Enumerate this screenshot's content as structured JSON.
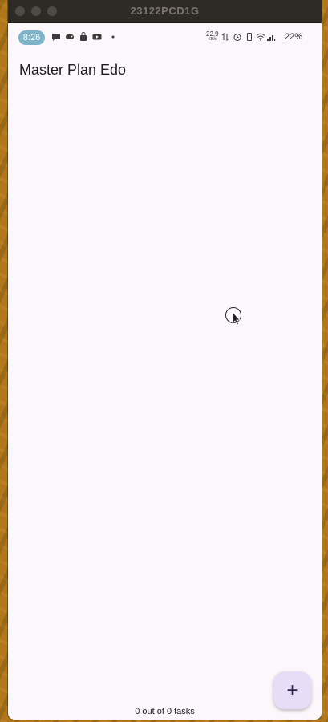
{
  "window": {
    "title": "23122PCD1G"
  },
  "statusbar": {
    "time": "8:26",
    "icons": [
      "chat-icon",
      "game-icon",
      "shopping-bag-icon",
      "youtube-icon",
      "dot-icon"
    ],
    "net_speed_value": "22,9",
    "net_speed_unit": "KB/s",
    "right_icons": [
      "data-arrows-icon",
      "alarm-icon",
      "vibrate-icon",
      "wifi-icon",
      "signal-icon"
    ],
    "battery": "22%"
  },
  "app": {
    "title": "Master Plan Edo",
    "fab_icon": "plus-icon",
    "fab_label": "+",
    "footer_text": "0 out of 0 tasks"
  },
  "colors": {
    "background": "#fcf7fb",
    "fab": "#e8ddf7",
    "time_pill": "#7fb3c8",
    "titlebar": "#2e2b27"
  }
}
